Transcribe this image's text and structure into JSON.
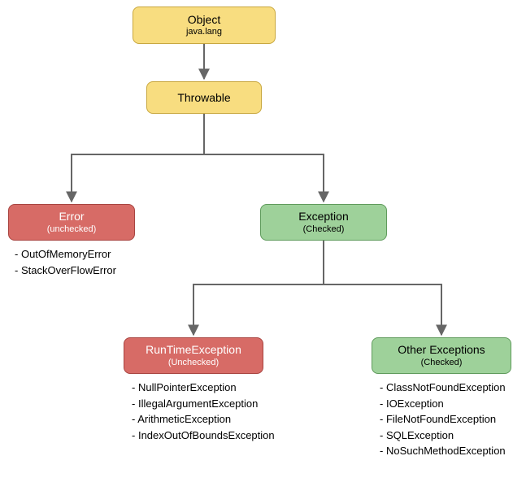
{
  "nodes": {
    "object": {
      "title": "Object",
      "sub": "java.lang"
    },
    "throwable": {
      "title": "Throwable"
    },
    "error": {
      "title": "Error",
      "sub": "(unchecked)"
    },
    "exception": {
      "title": "Exception",
      "sub": "(Checked)"
    },
    "runtime": {
      "title": "RunTimeException",
      "sub": "(Unchecked)"
    },
    "other": {
      "title": "Other Exceptions",
      "sub": "(Checked)"
    }
  },
  "lists": {
    "error": {
      "i0": "OutOfMemoryError",
      "i1": "StackOverFlowError"
    },
    "runtime": {
      "i0": "NullPointerException",
      "i1": "IllegalArgumentException",
      "i2": "ArithmeticException",
      "i3": "IndexOutOfBoundsException"
    },
    "other": {
      "i0": "ClassNotFoundException",
      "i1": "IOException",
      "i2": "FileNotFoundException",
      "i3": "SQLException",
      "i4": "NoSuchMethodException"
    }
  }
}
